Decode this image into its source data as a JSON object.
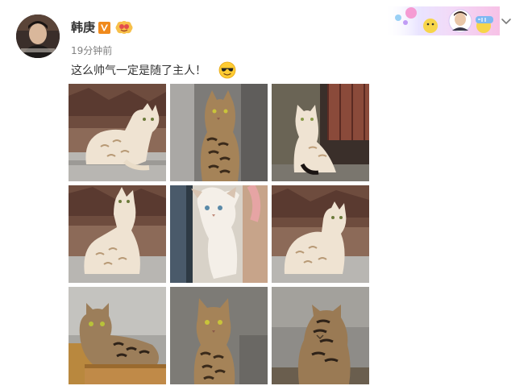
{
  "post": {
    "author": {
      "name": "韩庚",
      "verified": true,
      "verified_badge": "V"
    },
    "time": "19分钟前",
    "text": "这么帅气一定是随了主人！",
    "emoji": "cool-sunglasses-emoji",
    "photos": [
      {
        "subject": "snow bengal cat sitting, side view",
        "palette": "snow"
      },
      {
        "subject": "brown bengal cat sitting, front view",
        "palette": "brown"
      },
      {
        "subject": "snow bengal cat on balcony ledge",
        "palette": "snow"
      },
      {
        "subject": "snow bengal cat looking up",
        "palette": "snow"
      },
      {
        "subject": "snow bengal cat upside down, looking down",
        "palette": "snow"
      },
      {
        "subject": "snow bengal cat sitting, side view",
        "palette": "snow"
      },
      {
        "subject": "brown bengal cat crouching",
        "palette": "brown"
      },
      {
        "subject": "brown bengal cat sitting, front view",
        "palette": "brown"
      },
      {
        "subject": "brown bengal cat looking down",
        "palette": "brown"
      }
    ]
  },
  "colors": {
    "username": "#333333",
    "timestamp": "#808080",
    "text": "#333333",
    "verified_badge": "#f5a623",
    "brand_accent": "#ff8200"
  },
  "icons": {
    "verified": "verified-v-icon",
    "level": "level-badge-icon",
    "menu": "chevron-down-icon",
    "decoration": "card-decoration-icon"
  }
}
